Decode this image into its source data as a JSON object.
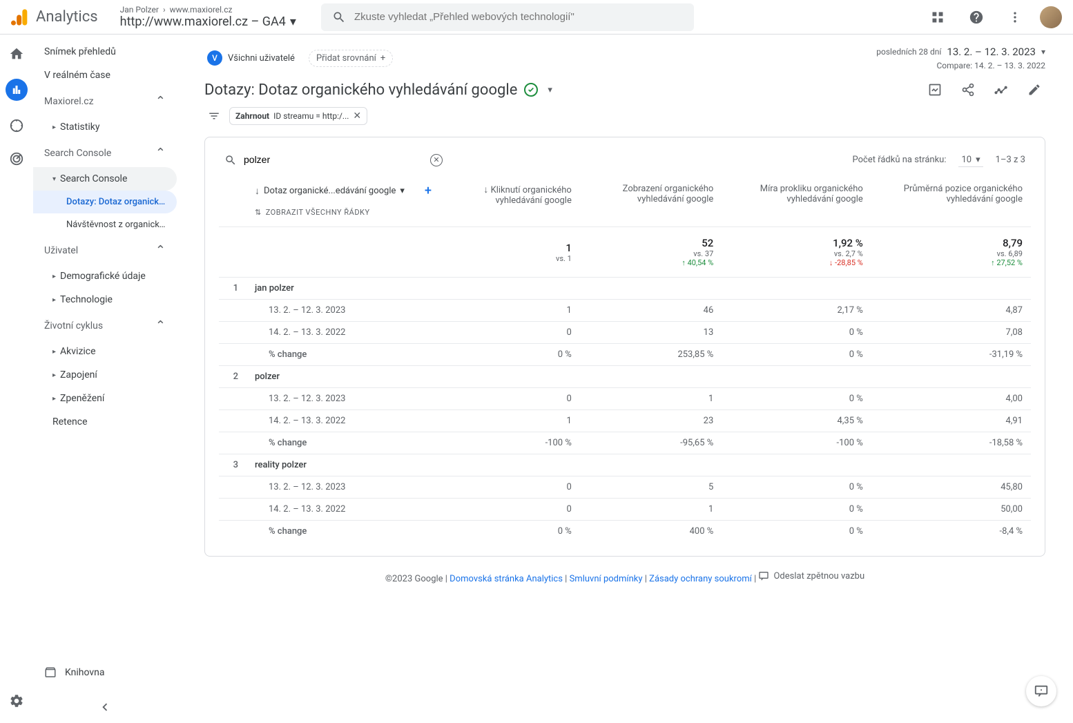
{
  "header": {
    "product": "Analytics",
    "breadcrumb_user": "Jan Polzer",
    "breadcrumb_site": "www.maxiorel.cz",
    "property": "http://www.maxiorel.cz – GA4",
    "search_placeholder": "Zkuste vyhledat „Přehled webových technologií\""
  },
  "sidebar": {
    "items": {
      "snapshot": "Snímek přehledů",
      "realtime": "V reálném čase",
      "library": "Knihovna"
    },
    "sections": {
      "maxiorel": {
        "label": "Maxiorel.cz",
        "statistiky": "Statistiky"
      },
      "search_console": {
        "label": "Search Console",
        "sc_item": "Search Console",
        "queries": "Dotazy: Dotaz organického...",
        "traffic": "Návštěvnost z organického..."
      },
      "user": {
        "label": "Uživatel",
        "demographics": "Demografické údaje",
        "technology": "Technologie"
      },
      "lifecycle": {
        "label": "Životní cyklus",
        "acquisition": "Akvizice",
        "engagement": "Zapojení",
        "monetization": "Zpeněžení",
        "retention": "Retence"
      }
    }
  },
  "toprow": {
    "segment_badge": "V",
    "segment_label": "Všichni uživatelé",
    "add_compare": "Přidat srovnání",
    "date_prefix": "posledních 28 dní",
    "date_range": "13. 2. – 12. 3. 2023",
    "compare_line": "Compare: 14. 2. – 13. 3. 2022"
  },
  "page": {
    "title": "Dotazy: Dotaz organického vyhledávání google",
    "filter_label": "Zahrnout",
    "filter_value": "ID streamu = http:/..."
  },
  "table": {
    "search_value": "polzer",
    "rows_per_page_label": "Počet řádků na stránku:",
    "rows_per_page_value": "10",
    "range_text": "1–3 z 3",
    "dimension_header": "Dotaz organické...edávání google",
    "show_all_rows": "ZOBRAZIT VŠECHNY ŘÁDKY",
    "columns": {
      "c1": "Kliknutí organického vyhledávání google",
      "c2": "Zobrazení organického vyhledávání google",
      "c3": "Míra prokliku organického vyhledávání google",
      "c4": "Průměrná pozice organického vyhledávání google"
    },
    "summary": {
      "c1": {
        "val": "1",
        "vs": "vs. 1",
        "delta": "",
        "dir": ""
      },
      "c2": {
        "val": "52",
        "vs": "vs. 37",
        "delta": "40,54 %",
        "dir": "up"
      },
      "c3": {
        "val": "1,92 %",
        "vs": "vs. 2,7 %",
        "delta": "-28,85 %",
        "dir": "down"
      },
      "c4": {
        "val": "8,79",
        "vs": "vs. 6,89",
        "delta": "27,52 %",
        "dir": "up"
      }
    },
    "period_current": "13. 2. – 12. 3. 2023",
    "period_previous": "14. 2. – 13. 3. 2022",
    "change_label": "% change",
    "rows": [
      {
        "idx": "1",
        "dim": "jan polzer",
        "current": {
          "c1": "1",
          "c2": "46",
          "c3": "2,17 %",
          "c4": "4,87"
        },
        "previous": {
          "c1": "0",
          "c2": "13",
          "c3": "0 %",
          "c4": "7,08"
        },
        "change": {
          "c1": "0 %",
          "c2": "253,85 %",
          "c3": "0 %",
          "c4": "-31,19 %"
        }
      },
      {
        "idx": "2",
        "dim": "polzer",
        "current": {
          "c1": "0",
          "c2": "1",
          "c3": "0 %",
          "c4": "4,00"
        },
        "previous": {
          "c1": "1",
          "c2": "23",
          "c3": "4,35 %",
          "c4": "4,91"
        },
        "change": {
          "c1": "-100 %",
          "c2": "-95,65 %",
          "c3": "-100 %",
          "c4": "-18,58 %"
        }
      },
      {
        "idx": "3",
        "dim": "reality polzer",
        "current": {
          "c1": "0",
          "c2": "5",
          "c3": "0 %",
          "c4": "45,80"
        },
        "previous": {
          "c1": "0",
          "c2": "1",
          "c3": "0 %",
          "c4": "50,00"
        },
        "change": {
          "c1": "0 %",
          "c2": "400 %",
          "c3": "0 %",
          "c4": "-8,4 %"
        }
      }
    ]
  },
  "footer": {
    "copyright": "©2023 Google",
    "home": "Domovská stránka Analytics",
    "terms": "Smluvní podmínky",
    "privacy": "Zásady ochrany soukromí",
    "feedback": "Odeslat zpětnou vazbu"
  }
}
